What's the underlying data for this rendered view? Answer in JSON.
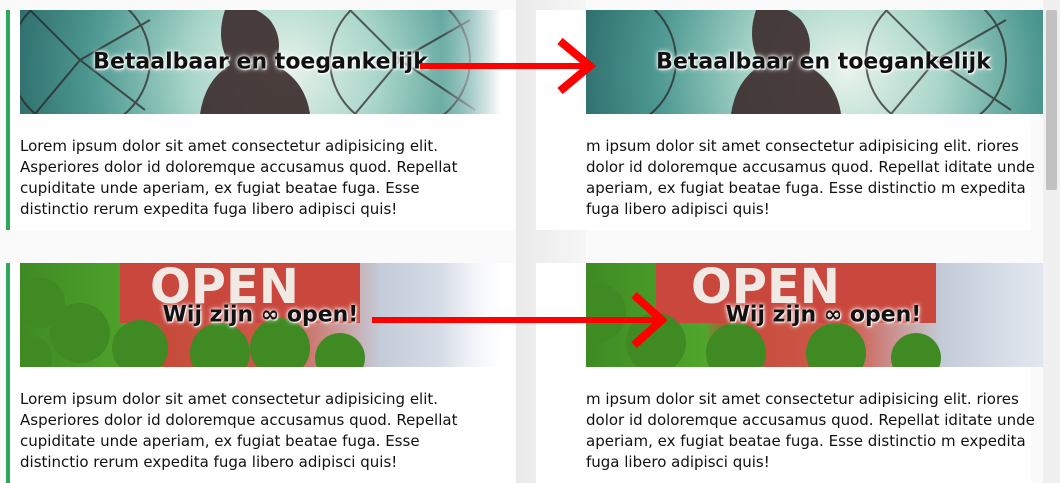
{
  "cards": [
    {
      "title": "Betaalbaar en toegankelijk",
      "text": "Lorem ipsum dolor sit amet consectetur adipisicing elit. Asperiores dolor id doloremque accusamus quod. Repellat cupiditate unde aperiam, ex fugiat beatae fuga. Esse distinctio rerum expedita fuga libero adipisci quis!",
      "image": "ferris-wheel-silhouette"
    },
    {
      "title": "Wij zijn ∞ open!",
      "text": "Lorem ipsum dolor sit amet consectetur adipisicing elit. Asperiores dolor id doloremque accusamus quod. Repellat cupiditate unde aperiam, ex fugiat beatae fuga. Esse distinctio rerum expedita fuga libero adipisci quis!",
      "image": "open-sign"
    }
  ],
  "right_cards": [
    {
      "title": "Betaalbaar en toegankelijk",
      "text": "m ipsum dolor sit amet consectetur adipisicing elit. riores dolor id doloremque accusamus quod. Repellat iditate unde aperiam, ex fugiat beatae fuga. Esse distinctio m expedita fuga libero adipisci quis!"
    },
    {
      "title": "Wij zijn ∞ open!",
      "text": "m ipsum dolor sit amet consectetur adipisicing elit. riores dolor id doloremque accusamus quod. Repellat iditate unde aperiam, ex fugiat beatae fuga. Esse distinctio m expedita fuga libero adipisci quis!"
    }
  ],
  "colors": {
    "accent_border": "#2fa85d",
    "arrow": "#ff0000"
  }
}
